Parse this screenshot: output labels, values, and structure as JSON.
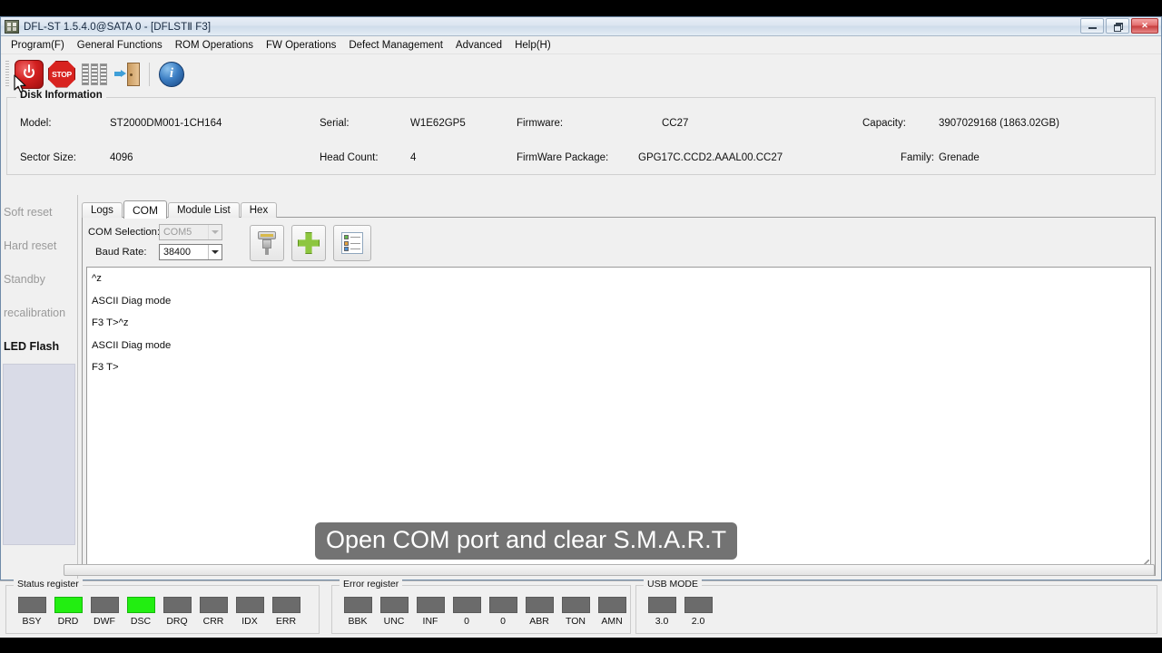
{
  "window": {
    "title": "DFL-ST 1.5.4.0@SATA 0 - [DFLSTⅡ F3]",
    "app_icon": "app-icon",
    "buttons": {
      "minimize": "minimize-button",
      "restore": "restore-button",
      "close": "✕"
    }
  },
  "menubar": {
    "items": [
      {
        "label": "Program(F)"
      },
      {
        "label": "General Functions"
      },
      {
        "label": "ROM Operations"
      },
      {
        "label": "FW Operations"
      },
      {
        "label": "Defect Management"
      },
      {
        "label": "Advanced"
      },
      {
        "label": "Help(H)"
      }
    ]
  },
  "toolbar": {
    "items": [
      {
        "name": "power-icon",
        "label": ""
      },
      {
        "name": "stop-icon",
        "label": "STOP"
      },
      {
        "name": "list-icon",
        "label": ""
      },
      {
        "name": "exit-icon",
        "label": ""
      },
      {
        "name": "info-icon",
        "label": "i"
      }
    ]
  },
  "disk_information": {
    "legend": "Disk Information",
    "row1": [
      {
        "label": "Model:",
        "value": "ST2000DM001-1CH164"
      },
      {
        "label": "Serial:",
        "value": "W1E62GP5"
      },
      {
        "label": "Firmware:",
        "value": "CC27"
      },
      {
        "label": "Capacity:",
        "value": "3907029168 (1863.02GB)"
      }
    ],
    "row2": [
      {
        "label": "Sector Size:",
        "value": "4096"
      },
      {
        "label": "Head Count:",
        "value": "4"
      },
      {
        "label": "FirmWare Package:",
        "value": "GPG17C.CCD2.AAAL00.CC27"
      },
      {
        "label": "Family:",
        "value": "Grenade"
      }
    ]
  },
  "sidebar": {
    "items": [
      {
        "label": "Soft reset",
        "enabled": false
      },
      {
        "label": "Hard reset",
        "enabled": false
      },
      {
        "label": "Standby",
        "enabled": false
      },
      {
        "label": "recalibration",
        "enabled": false
      },
      {
        "label": "LED Flash",
        "enabled": true
      }
    ]
  },
  "tabs": [
    {
      "label": "Logs",
      "active": false
    },
    {
      "label": "COM",
      "active": true
    },
    {
      "label": "Module List",
      "active": false
    },
    {
      "label": "Hex",
      "active": false
    }
  ],
  "com_panel": {
    "com_selection": {
      "label": "COM Selection:",
      "value": "COM5",
      "enabled": false
    },
    "baud_rate": {
      "label": "Baud Rate:",
      "value": "38400",
      "enabled": true
    },
    "buttons": [
      {
        "name": "serial-port-button"
      },
      {
        "name": "add-button"
      },
      {
        "name": "module-list-button"
      }
    ],
    "terminal_lines": [
      "^z",
      "ASCII Diag mode",
      "F3 T>^z",
      "ASCII Diag mode",
      "F3 T>"
    ]
  },
  "subtitle": {
    "text": "Open COM port and clear S.M.A.R.T"
  },
  "status_bar": {
    "status_register": {
      "legend": "Status register",
      "leds": [
        {
          "label": "BSY",
          "on": false
        },
        {
          "label": "DRD",
          "on": true
        },
        {
          "label": "DWF",
          "on": false
        },
        {
          "label": "DSC",
          "on": true
        },
        {
          "label": "DRQ",
          "on": false
        },
        {
          "label": "CRR",
          "on": false
        },
        {
          "label": "IDX",
          "on": false
        },
        {
          "label": "ERR",
          "on": false
        }
      ]
    },
    "error_register": {
      "legend": "Error register",
      "leds": [
        {
          "label": "BBK",
          "on": false
        },
        {
          "label": "UNC",
          "on": false
        },
        {
          "label": "INF",
          "on": false
        },
        {
          "label": "0",
          "on": false
        },
        {
          "label": "0",
          "on": false
        },
        {
          "label": "ABR",
          "on": false
        },
        {
          "label": "TON",
          "on": false
        },
        {
          "label": "AMN",
          "on": false
        }
      ]
    },
    "usb_mode": {
      "legend": "USB MODE",
      "leds": [
        {
          "label": "3.0",
          "on": false
        },
        {
          "label": "2.0",
          "on": false
        }
      ]
    }
  },
  "colors": {
    "led_on": "#22ee11",
    "led_off": "#6b6b6b",
    "accent_red": "#d21f1f",
    "window_bg": "#f0f0f0",
    "sidebar_fill": "#d9dbe7"
  }
}
